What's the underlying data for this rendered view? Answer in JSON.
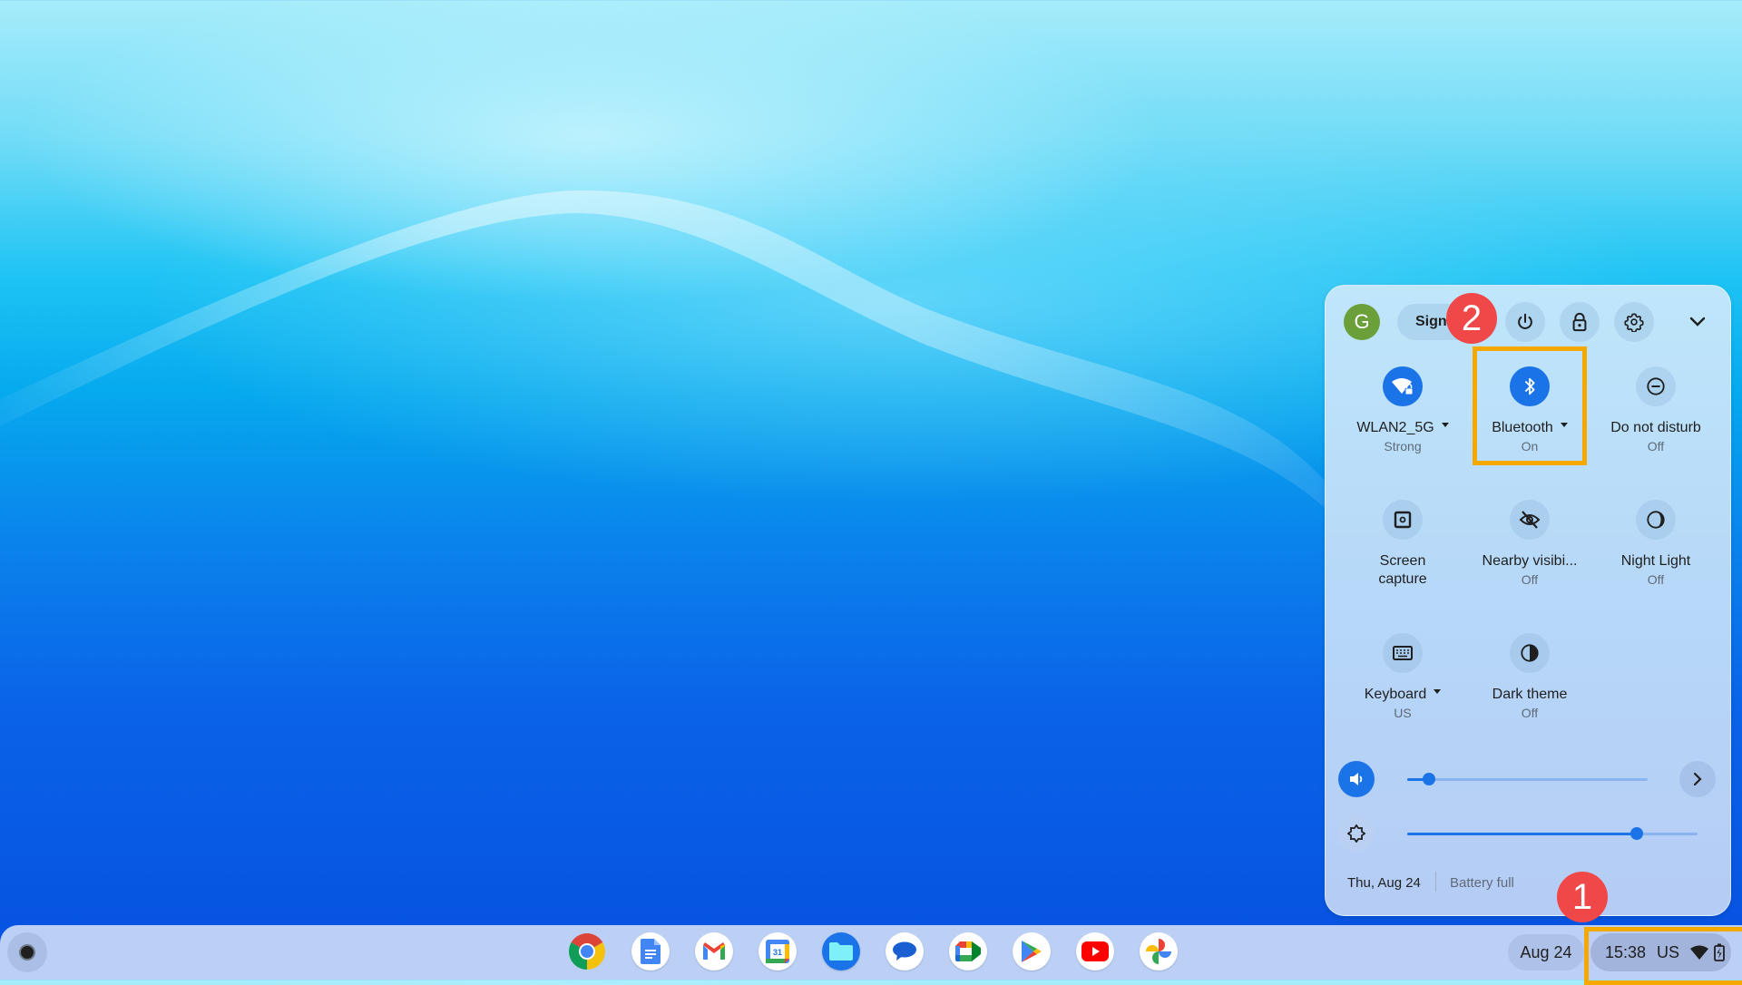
{
  "desktop": {
    "wallpaper": "blue-wave"
  },
  "quick_settings": {
    "avatar_initial": "G",
    "sign_out_label": "Sign",
    "header_buttons": [
      "power-icon",
      "lock-icon",
      "settings-icon",
      "collapse-chevron-icon"
    ],
    "tiles": [
      {
        "id": "wifi",
        "label": "WLAN2_5G",
        "sub": "Strong",
        "icon": "wifi-lock-icon",
        "on": true,
        "has_menu": true
      },
      {
        "id": "bluetooth",
        "label": "Bluetooth",
        "sub": "On",
        "icon": "bluetooth-icon",
        "on": true,
        "has_menu": true
      },
      {
        "id": "dnd",
        "label": "Do not disturb",
        "sub": "Off",
        "icon": "do-not-disturb-icon",
        "on": false,
        "has_menu": false
      },
      {
        "id": "screen-capture",
        "label": "Screen",
        "label2": "capture",
        "sub": "",
        "icon": "screen-capture-icon",
        "on": false,
        "has_menu": false
      },
      {
        "id": "nearby",
        "label": "Nearby visibi...",
        "sub": "Off",
        "icon": "visibility-off-icon",
        "on": false,
        "has_menu": false
      },
      {
        "id": "night-light",
        "label": "Night Light",
        "sub": "Off",
        "icon": "night-light-icon",
        "on": false,
        "has_menu": false
      },
      {
        "id": "keyboard",
        "label": "Keyboard",
        "sub": "US",
        "icon": "keyboard-icon",
        "on": false,
        "has_menu": true
      },
      {
        "id": "dark-theme",
        "label": "Dark theme",
        "sub": "Off",
        "icon": "dark-theme-icon",
        "on": false,
        "has_menu": false
      }
    ],
    "volume_percent": 9,
    "brightness_percent": 79,
    "footer": {
      "date": "Thu, Aug 24",
      "battery": "Battery full"
    },
    "colors": {
      "accent": "#1b73e8",
      "highlight": "#f5a800",
      "badge": "#f04848"
    }
  },
  "annotations": {
    "badge_1": "1",
    "badge_2": "2"
  },
  "shelf": {
    "apps": [
      "Chrome",
      "Docs",
      "Gmail",
      "Calendar",
      "Files",
      "Messages",
      "Meet",
      "Play Store",
      "YouTube",
      "Photos"
    ],
    "calendar_day": "31",
    "date_pill": "Aug 24",
    "status": {
      "time": "15:38",
      "ime": "US"
    }
  }
}
